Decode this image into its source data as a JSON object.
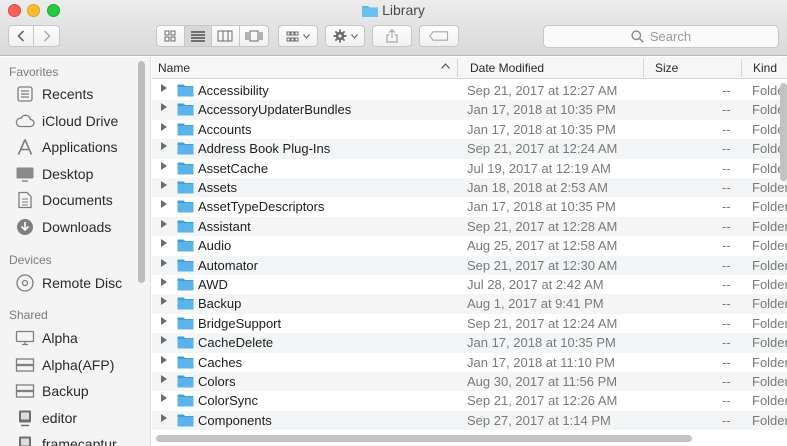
{
  "window": {
    "title": "Library"
  },
  "toolbar": {
    "search_placeholder": "Search",
    "icons": {
      "back": "chevron-left-icon",
      "forward": "chevron-right-icon",
      "view_icon": "icon-view-icon",
      "view_list": "list-view-icon",
      "view_columns": "column-view-icon",
      "view_gallery": "cover-flow-icon",
      "arrange": "arrange-grid-icon",
      "action": "gear-icon",
      "share": "share-icon",
      "tags": "tag-icon",
      "search": "magnifier-icon"
    },
    "active_view": "list"
  },
  "sidebar": {
    "sections": [
      {
        "heading": "Favorites",
        "items": [
          {
            "label": "Recents",
            "icon": "clock-icon"
          },
          {
            "label": "iCloud Drive",
            "icon": "cloud-icon"
          },
          {
            "label": "Applications",
            "icon": "applications-icon"
          },
          {
            "label": "Desktop",
            "icon": "desktop-icon"
          },
          {
            "label": "Documents",
            "icon": "document-icon"
          },
          {
            "label": "Downloads",
            "icon": "download-icon"
          }
        ]
      },
      {
        "heading": "Devices",
        "items": [
          {
            "label": "Remote Disc",
            "icon": "disc-icon"
          }
        ]
      },
      {
        "heading": "Shared",
        "items": [
          {
            "label": "Alpha",
            "icon": "monitor-icon"
          },
          {
            "label": "Alpha(AFP)",
            "icon": "server-icon"
          },
          {
            "label": "Backup",
            "icon": "server-icon"
          },
          {
            "label": "editor",
            "icon": "computer-icon"
          },
          {
            "label": "framecaptur",
            "icon": "computer-icon"
          }
        ]
      }
    ]
  },
  "columns": {
    "name": "Name",
    "date": "Date Modified",
    "size": "Size",
    "kind": "Kind"
  },
  "rows": [
    {
      "name": "Accessibility",
      "date": "Sep 21, 2017 at 12:27 AM",
      "size": "--",
      "kind": "Folder"
    },
    {
      "name": "AccessoryUpdaterBundles",
      "date": "Jan 17, 2018 at 10:35 PM",
      "size": "--",
      "kind": "Folder"
    },
    {
      "name": "Accounts",
      "date": "Jan 17, 2018 at 10:35 PM",
      "size": "--",
      "kind": "Folder"
    },
    {
      "name": "Address Book Plug-Ins",
      "date": "Sep 21, 2017 at 12:24 AM",
      "size": "--",
      "kind": "Folder"
    },
    {
      "name": "AssetCache",
      "date": "Jul 19, 2017 at 12:19 AM",
      "size": "--",
      "kind": "Folder"
    },
    {
      "name": "Assets",
      "date": "Jan 18, 2018 at 2:53 AM",
      "size": "--",
      "kind": "Folder"
    },
    {
      "name": "AssetTypeDescriptors",
      "date": "Jan 17, 2018 at 10:35 PM",
      "size": "--",
      "kind": "Folder"
    },
    {
      "name": "Assistant",
      "date": "Sep 21, 2017 at 12:28 AM",
      "size": "--",
      "kind": "Folder"
    },
    {
      "name": "Audio",
      "date": "Aug 25, 2017 at 12:58 AM",
      "size": "--",
      "kind": "Folder"
    },
    {
      "name": "Automator",
      "date": "Sep 21, 2017 at 12:30 AM",
      "size": "--",
      "kind": "Folder"
    },
    {
      "name": "AWD",
      "date": "Jul 28, 2017 at 2:42 AM",
      "size": "--",
      "kind": "Folder"
    },
    {
      "name": "Backup",
      "date": "Aug 1, 2017 at 9:41 PM",
      "size": "--",
      "kind": "Folder"
    },
    {
      "name": "BridgeSupport",
      "date": "Sep 21, 2017 at 12:24 AM",
      "size": "--",
      "kind": "Folder"
    },
    {
      "name": "CacheDelete",
      "date": "Jan 17, 2018 at 10:35 PM",
      "size": "--",
      "kind": "Folder"
    },
    {
      "name": "Caches",
      "date": "Jan 17, 2018 at 11:10 PM",
      "size": "--",
      "kind": "Folder"
    },
    {
      "name": "Colors",
      "date": "Aug 30, 2017 at 11:56 PM",
      "size": "--",
      "kind": "Folder"
    },
    {
      "name": "ColorSync",
      "date": "Sep 21, 2017 at 12:26 AM",
      "size": "--",
      "kind": "Folder"
    },
    {
      "name": "Components",
      "date": "Sep 27, 2017 at 1:14 PM",
      "size": "--",
      "kind": "Folder"
    }
  ],
  "colors": {
    "folder": "#5ab4ea",
    "folder_tab": "#3e9fd9",
    "row_alt": "#f3f5f7"
  }
}
